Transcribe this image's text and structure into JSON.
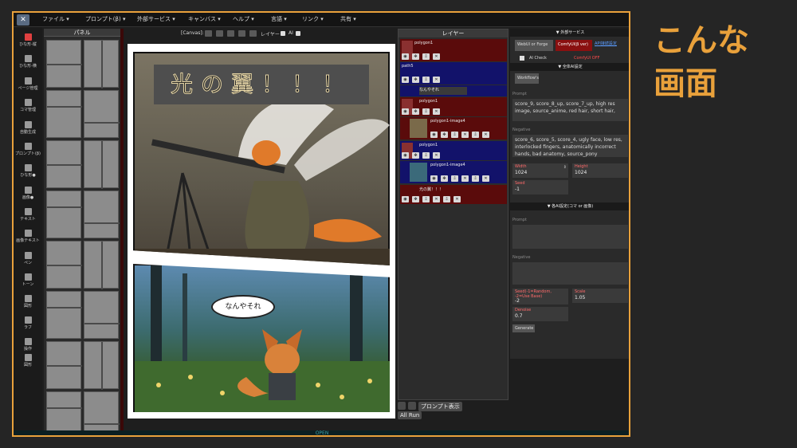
{
  "menu": [
    "ファイル ▾",
    "プロンプト(β) ▾",
    "外部サービス ▾",
    "キャンバス ▾",
    "ヘルプ ▾",
    "言語 ▾",
    "リンク ▾",
    "共有 ▾"
  ],
  "tools": [
    "ひな形-縦",
    "ひな形-横",
    "ページ管理",
    "コマ管理",
    "自動生成",
    "プロンプト(β)",
    "ひな形●",
    "画像●",
    "テキスト",
    "画像テキスト",
    "ペン",
    "トーン",
    "図形",
    "ラフ",
    "操作",
    "図形"
  ],
  "panel": {
    "title": "パネル"
  },
  "canvas_bar": {
    "label": "[Canvas]:",
    "layer_label": "レイヤー",
    "ai_label": "AI"
  },
  "page": {
    "title_text": "光の翼！！！",
    "speech": "なんやそれ"
  },
  "layers": {
    "title": "レイヤー",
    "rows": [
      {
        "name": "polygon1",
        "bg": "#5a0b0b"
      },
      {
        "name": "path5",
        "bg": "#12126a"
      },
      {
        "name": "なんやそれ",
        "bg": "#12126a"
      },
      {
        "name": "polygon1",
        "bg": "#5a0b0b"
      },
      {
        "name": "polygon1-image4",
        "bg": "#5a0b0b"
      },
      {
        "name": "polygon1",
        "bg": "#12126a"
      },
      {
        "name": "polygon1-image4",
        "bg": "#12126a"
      },
      {
        "name": "光の翼！！！",
        "bg": "#5a0b0b"
      }
    ],
    "show_prompt": "プロンプト表示",
    "all_run": "All Run"
  },
  "right": {
    "ext_service": "▼ 外部サービス",
    "webui": "WebUI or Forge",
    "comfy": "ComfyUI(β ver)",
    "api_link": "API接続設定",
    "ai_check": "AI Check",
    "comfy_status": "ComfyUI OFF",
    "global_ai": "▼ 全体AI設定",
    "workflows": "Workflow's",
    "prompt_label": "Prompt",
    "prompt_value": "score_9, score_8_up, score_7_up, high res image, source_anime, red hair, short hair,",
    "negative_label": "Negative",
    "negative_value": "score_6, score_5, score_4, ugly face, low res, interlocked fingers, anatomically incorrect hands, bad anatomy, source_pony",
    "width_label": "Width",
    "width_value": "1024",
    "height_label": "Height",
    "height_value": "1024",
    "seed_label": "Seed",
    "seed_value": "-1",
    "each_ai": "▼ 各AI設定(コマ or 画像)",
    "prompt2_label": "Prompt",
    "negative2_label": "Negative",
    "seed2_label": "Seed(-1=Random, -2=Use Base)",
    "seed2_value": "-2",
    "scale_label": "Scale",
    "scale_value": "1.05",
    "denoise_label": "Denoise",
    "denoise_value": "0.7",
    "generate": "Generate"
  },
  "open_label": "OPEN",
  "caption": [
    "こんな",
    "画面"
  ]
}
